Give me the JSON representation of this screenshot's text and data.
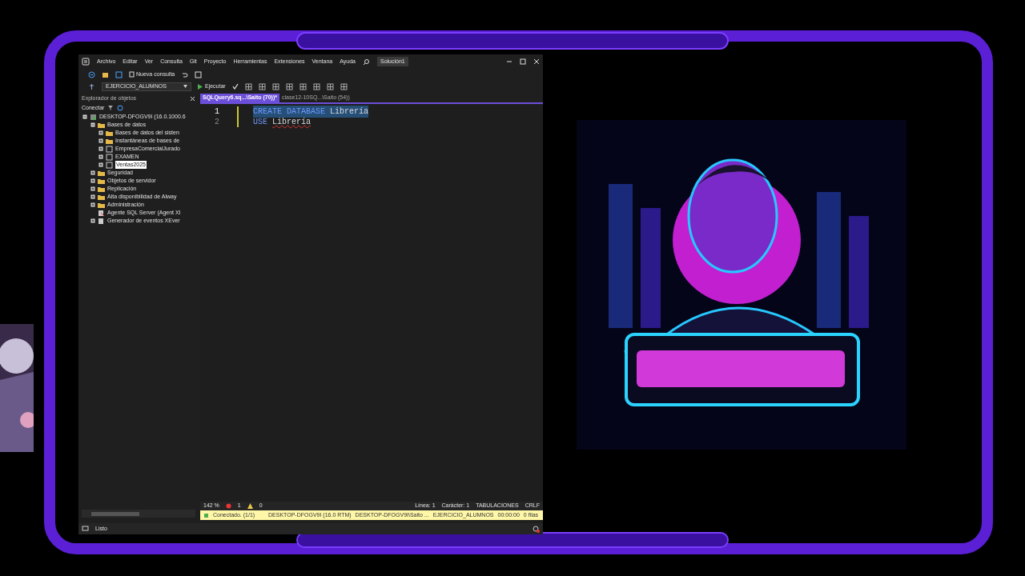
{
  "window": {
    "menu": [
      "Archivo",
      "Editar",
      "Ver",
      "Consulta",
      "Git",
      "Proyecto",
      "Herramientas",
      "Extensiones",
      "Ventana",
      "Ayuda"
    ],
    "solution": "Solución1"
  },
  "toolbar": {
    "new_query": "Nueva consulta",
    "database": "EJERCICIO_ALUMNOS",
    "execute": "Ejecutar"
  },
  "object_explorer": {
    "title": "Explorador de objetos",
    "connect": "Conectar",
    "tree": [
      {
        "label": "DESKTOP-DFOGV9I (16.0.1000.6",
        "kind": "server",
        "expanded": true,
        "selected": false,
        "children": [
          {
            "label": "Bases de datos",
            "kind": "folder",
            "expanded": true,
            "selected": false,
            "children": [
              {
                "label": "Bases de datos del sisten",
                "kind": "folder",
                "expanded": false,
                "selected": false
              },
              {
                "label": "Instantáneas de bases de",
                "kind": "folder",
                "expanded": false,
                "selected": false
              },
              {
                "label": "EmpresaComercialJurado",
                "kind": "database",
                "expanded": false,
                "selected": false
              },
              {
                "label": "EXAMEN",
                "kind": "database",
                "expanded": false,
                "selected": false
              },
              {
                "label": "Ventas2025",
                "kind": "database",
                "expanded": false,
                "selected": true
              }
            ]
          },
          {
            "label": "Seguridad",
            "kind": "folder",
            "expanded": false,
            "selected": false
          },
          {
            "label": "Objetos de servidor",
            "kind": "folder",
            "expanded": false,
            "selected": false
          },
          {
            "label": "Replicación",
            "kind": "folder",
            "expanded": false,
            "selected": false
          },
          {
            "label": "Alta disponibilidad de Alway",
            "kind": "folder",
            "expanded": false,
            "selected": false
          },
          {
            "label": "Administración",
            "kind": "folder",
            "expanded": false,
            "selected": false
          },
          {
            "label": "Agente SQL Server (Agent XI",
            "kind": "agent",
            "selected": false
          },
          {
            "label": "Generador de eventos XEver",
            "kind": "xevent",
            "expanded": false,
            "selected": false
          }
        ]
      }
    ]
  },
  "tabs": [
    {
      "label": "SQLQuery6.sq...\\Saito (70))*",
      "selected": true
    },
    {
      "label": "clase12-10SQ...\\Saito (54))",
      "selected": false
    }
  ],
  "editor": {
    "lines": [
      {
        "number": "1",
        "keyword": "CREATE DATABASE",
        "name": "Librería",
        "selected": true
      },
      {
        "number": "2",
        "keyword": "USE",
        "name": "Librería",
        "selected": false
      }
    ]
  },
  "editor_status": {
    "zoom": "142 %",
    "errors": "1",
    "warnings": "0",
    "line": "Línea: 1",
    "column": "Carácter: 1",
    "indent": "TABULACIONES",
    "eol": "CRLF"
  },
  "connection_bar": {
    "status": "Conectado. (1/1)",
    "fields": [
      "DESKTOP-DFOGV9I (16.0 RTM)",
      "DESKTOP-DFOGV9I\\Saito ...",
      "EJERCICIO_ALUMNOS",
      "00:00:00",
      "0 filas"
    ]
  },
  "status_bar": {
    "text": "Listo"
  }
}
